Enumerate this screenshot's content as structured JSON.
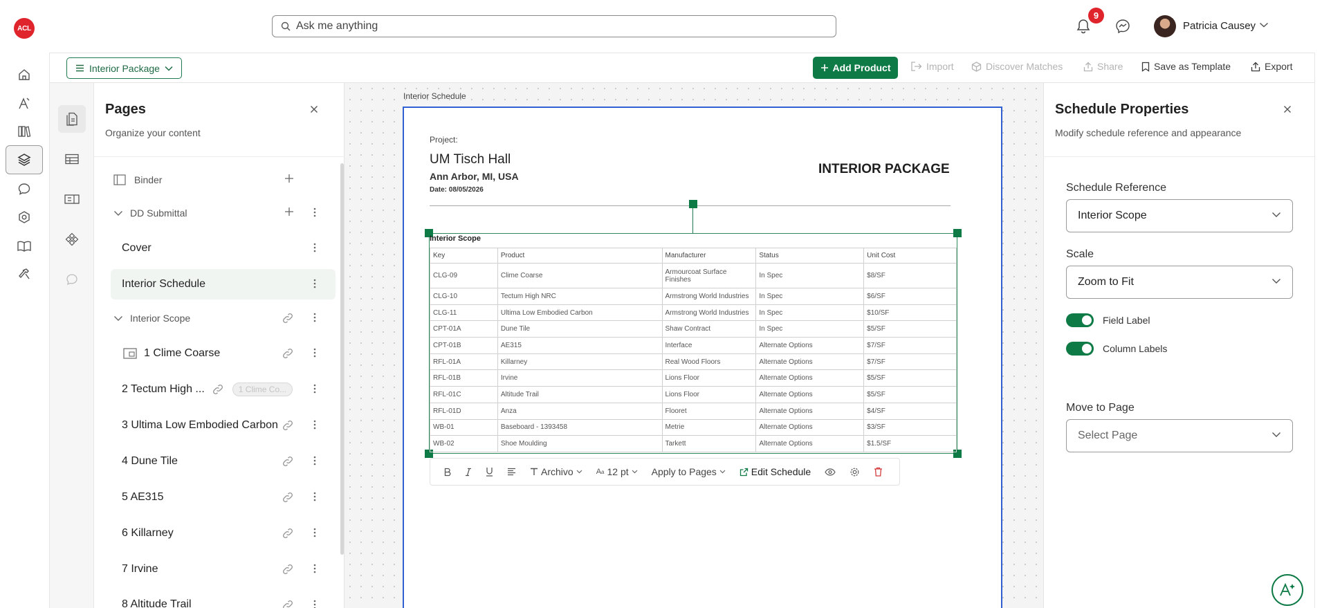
{
  "brand": {
    "logo_text": "ACL",
    "accent": "#0e7a45",
    "alert": "#e0242b",
    "selection": "#2f5fd0"
  },
  "header": {
    "search_placeholder": "Ask me anything",
    "notification_count": "9",
    "user_name": "Patricia Causey"
  },
  "rail": {
    "items": [
      "home-icon",
      "design-tool-icon",
      "library-icon",
      "layers-icon",
      "chat-icon",
      "settings-hex-icon",
      "book-icon",
      "hammer-icon"
    ],
    "active": "layers-icon"
  },
  "toolbar": {
    "package_label": "Interior Package",
    "add_product": "Add Product",
    "import": "Import",
    "discover": "Discover Matches",
    "share": "Share",
    "save_template": "Save as Template",
    "export": "Export"
  },
  "pages_panel": {
    "title": "Pages",
    "subtitle": "Organize your content",
    "binder": "Binder",
    "dd_submittal": "DD Submittal",
    "cover": "Cover",
    "interior_schedule": "Interior Schedule",
    "interior_scope": "Interior Scope",
    "items": [
      {
        "label": "1 Clime Coarse"
      },
      {
        "label": "2 Tectum High ...",
        "chip": "1 Clime Co..."
      },
      {
        "label": "3 Ultima Low Embodied Carbon"
      },
      {
        "label": "4 Dune Tile"
      },
      {
        "label": "5 AE315"
      },
      {
        "label": "6 Killarney"
      },
      {
        "label": "7 Irvine"
      },
      {
        "label": "8 Altitude Trail"
      }
    ]
  },
  "canvas": {
    "page_label": "Interior Schedule",
    "project_label": "Project:",
    "project_name": "UM Tisch Hall",
    "project_location": "Ann Arbor, MI, USA",
    "project_date": "Date: 08/05/2026",
    "package_title": "INTERIOR PACKAGE",
    "schedule_title": "Interior Scope",
    "columns": [
      "Key",
      "Product",
      "Manufacturer",
      "Status",
      "Unit Cost"
    ],
    "rows": [
      [
        "CLG-09",
        "Clime Coarse",
        "Armourcoat Surface Finishes",
        "In Spec",
        "$8/SF"
      ],
      [
        "CLG-10",
        "Tectum High NRC",
        "Armstrong World Industries",
        "In Spec",
        "$6/SF"
      ],
      [
        "CLG-11",
        "Ultima Low Embodied Carbon",
        "Armstrong World Industries",
        "In Spec",
        "$10/SF"
      ],
      [
        "CPT-01A",
        "Dune Tile",
        "Shaw Contract",
        "In Spec",
        "$5/SF"
      ],
      [
        "CPT-01B",
        "AE315",
        "Interface",
        "Alternate Options",
        "$7/SF"
      ],
      [
        "RFL-01A",
        "Killarney",
        "Real Wood Floors",
        "Alternate Options",
        "$7/SF"
      ],
      [
        "RFL-01B",
        "Irvine",
        "Lions Floor",
        "Alternate Options",
        "$5/SF"
      ],
      [
        "RFL-01C",
        "Altitude Trail",
        "Lions Floor",
        "Alternate Options",
        "$5/SF"
      ],
      [
        "RFL-01D",
        "Anza",
        "Flooret",
        "Alternate Options",
        "$4/SF"
      ],
      [
        "WB-01",
        "Baseboard - 1393458",
        "Metrie",
        "Alternate Options",
        "$3/SF"
      ],
      [
        "WB-02",
        "Shoe Moulding",
        "Tarkett",
        "Alternate Options",
        "$1.5/SF"
      ]
    ]
  },
  "text_toolbar": {
    "font": "Archivo",
    "size": "12 pt",
    "apply": "Apply to Pages",
    "edit": "Edit Schedule"
  },
  "properties": {
    "title": "Schedule Properties",
    "subtitle": "Modify schedule reference and appearance",
    "ref_label": "Schedule Reference",
    "ref_value": "Interior Scope",
    "scale_label": "Scale",
    "scale_value": "Zoom to Fit",
    "field_label": "Field Label",
    "field_label_on": true,
    "column_labels": "Column Labels",
    "column_labels_on": true,
    "move_label": "Move to Page",
    "move_placeholder": "Select Page"
  }
}
